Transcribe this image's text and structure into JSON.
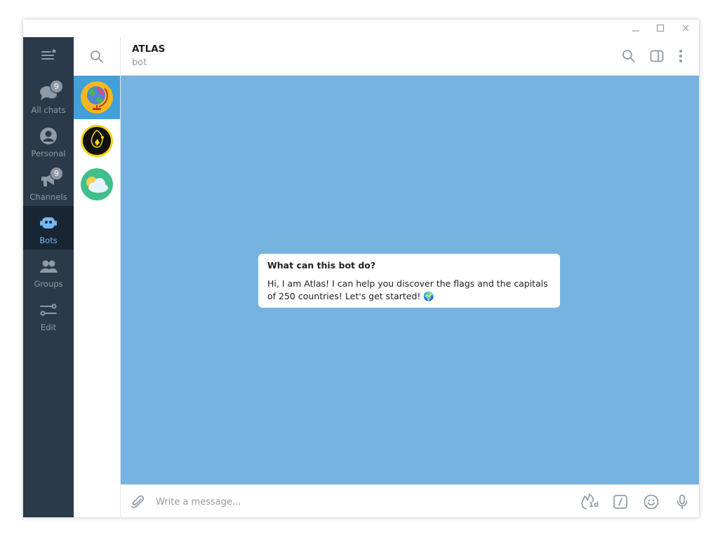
{
  "sidebar": {
    "folders": [
      {
        "label": "All chats",
        "badge": "9"
      },
      {
        "label": "Personal"
      },
      {
        "label": "Channels",
        "badge": "9"
      },
      {
        "label": "Bots"
      },
      {
        "label": "Groups"
      },
      {
        "label": "Edit"
      }
    ],
    "active_folder": "Bots"
  },
  "chat_list": {
    "items": [
      {
        "avatar": "globe-avatar",
        "selected": true
      },
      {
        "avatar": "black-yellow-avatar",
        "selected": false
      },
      {
        "avatar": "weather-cloud-avatar",
        "selected": false
      }
    ]
  },
  "header": {
    "title": "ATLAS",
    "subtitle": "bot"
  },
  "bot_info": {
    "title": "What can this bot do?",
    "text": "Hi, I am Atlas! I can help you discover the flags and the capitals of 250 countries! Let's get started! 🌍"
  },
  "composer": {
    "placeholder": "Write a message...",
    "timer_label": "1d"
  },
  "colors": {
    "sidebar": "#2b3a4b",
    "active_folder_bg": "#182634",
    "accent": "#419fd9",
    "chat_background": "#77b3e0"
  }
}
